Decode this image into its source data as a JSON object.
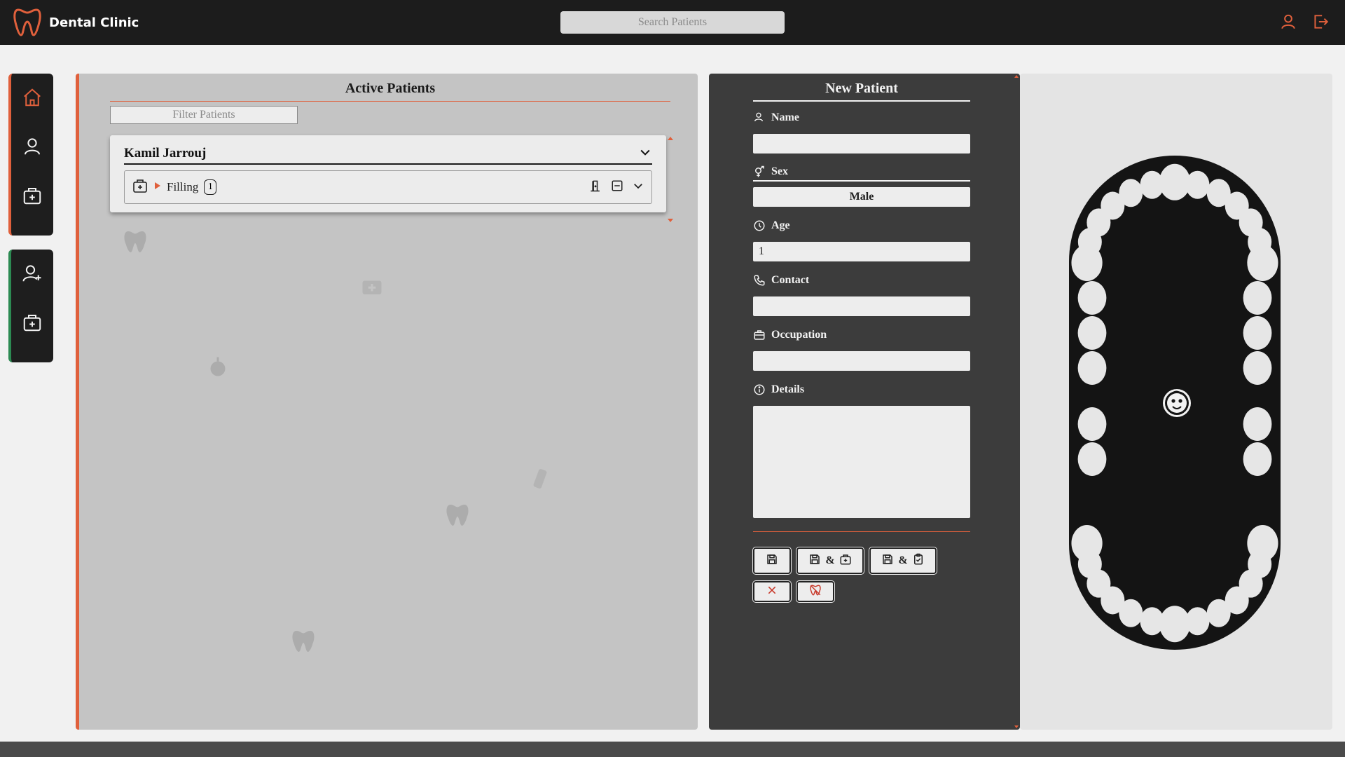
{
  "app": {
    "title": "Dental Clinic"
  },
  "search": {
    "placeholder": "Search Patients"
  },
  "colors": {
    "accent": "#e0603c",
    "green": "#2c8a52",
    "dark": "#1c1c1c"
  },
  "topbar_icons": [
    "user-icon",
    "logout-icon"
  ],
  "sidebar": {
    "group1": [
      "home-icon",
      "user-icon",
      "clinic-case-icon"
    ],
    "group2": [
      "add-user-icon",
      "clinic-case-add-icon"
    ]
  },
  "active_patients": {
    "title": "Active Patients",
    "filter_placeholder": "Filter Patients",
    "patients": [
      {
        "name": "Kamil Jarrouj",
        "treatments": [
          {
            "label": "Filling",
            "count": "1"
          }
        ]
      }
    ]
  },
  "new_patient": {
    "title": "New Patient",
    "fields": {
      "name": {
        "label": "Name",
        "value": ""
      },
      "sex": {
        "label": "Sex",
        "value": "Male"
      },
      "age": {
        "label": "Age",
        "value": "1"
      },
      "contact": {
        "label": "Contact",
        "value": ""
      },
      "occupation": {
        "label": "Occupation",
        "value": ""
      },
      "details": {
        "label": "Details",
        "value": ""
      }
    },
    "buttons": {
      "amp1": "&",
      "amp2": "&"
    }
  },
  "tooth_chart": {
    "center_icon": "child-face-icon"
  }
}
